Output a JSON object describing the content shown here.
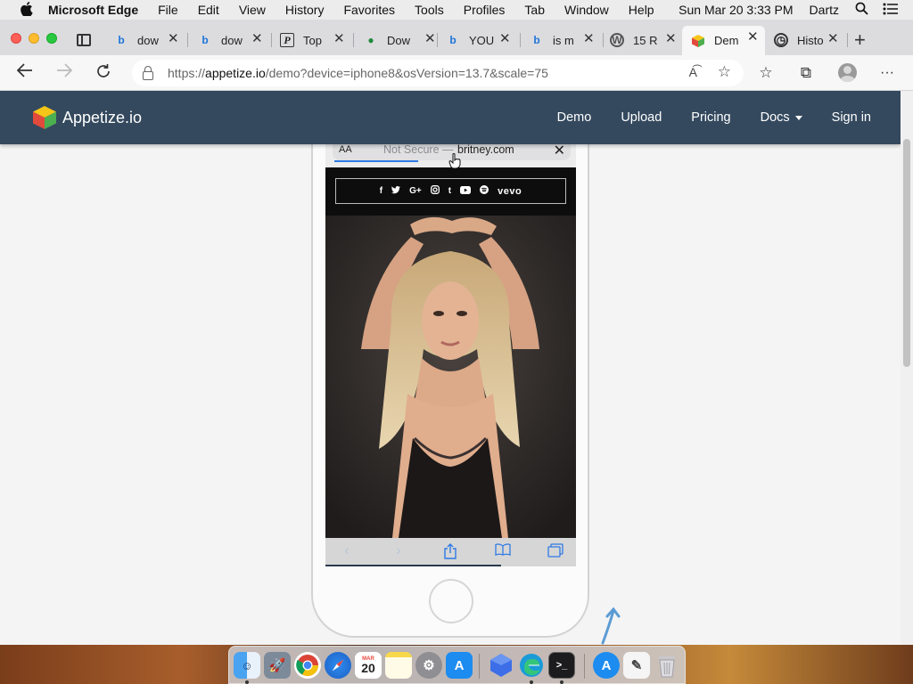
{
  "menubar": {
    "app_name": "Microsoft Edge",
    "items": [
      "File",
      "Edit",
      "View",
      "History",
      "Favorites",
      "Tools",
      "Profiles",
      "Tab",
      "Window",
      "Help"
    ],
    "clock": "Sun Mar 20  3:33 PM",
    "user": "Dartz"
  },
  "tabs": [
    {
      "label": "dow",
      "icon": "bing-icon"
    },
    {
      "label": "dow",
      "icon": "bing-icon"
    },
    {
      "label": "Top",
      "icon": "p-site-icon"
    },
    {
      "label": "Dow",
      "icon": "leaf-site-icon"
    },
    {
      "label": "YOU",
      "icon": "bing-icon"
    },
    {
      "label": "is m",
      "icon": "bing-icon"
    },
    {
      "label": "15 R",
      "icon": "wordpress-icon"
    },
    {
      "label": "Dem",
      "icon": "appetize-icon",
      "active": true
    },
    {
      "label": "Histo",
      "icon": "history-icon"
    }
  ],
  "address_bar": {
    "url_prefix": "https://",
    "url_host": "appetize.io",
    "url_rest": "/demo?device=iphone8&osVersion=13.7&scale=75"
  },
  "site": {
    "brand": "Appetize.io",
    "nav": [
      "Demo",
      "Upload",
      "Pricing",
      "Docs",
      "Sign in"
    ]
  },
  "device_screen": {
    "text_size_label": "AA",
    "security_label": "Not Secure —",
    "domain": "britney.com",
    "social_icons": [
      "f",
      "twitter",
      "G+",
      "instagram",
      "t",
      "youtube",
      "spotify"
    ],
    "vevo_label": "vevo"
  },
  "dock": {
    "apps": [
      "Finder",
      "Launchpad",
      "Chrome",
      "Safari",
      "Calendar",
      "Notes",
      "System Preferences",
      "App Store",
      "Xcode Instruments",
      "Microsoft Edge",
      "Terminal",
      "App Store Utility",
      "TextEdit",
      "Trash"
    ],
    "calendar_day": "20",
    "calendar_month": "MAR"
  }
}
